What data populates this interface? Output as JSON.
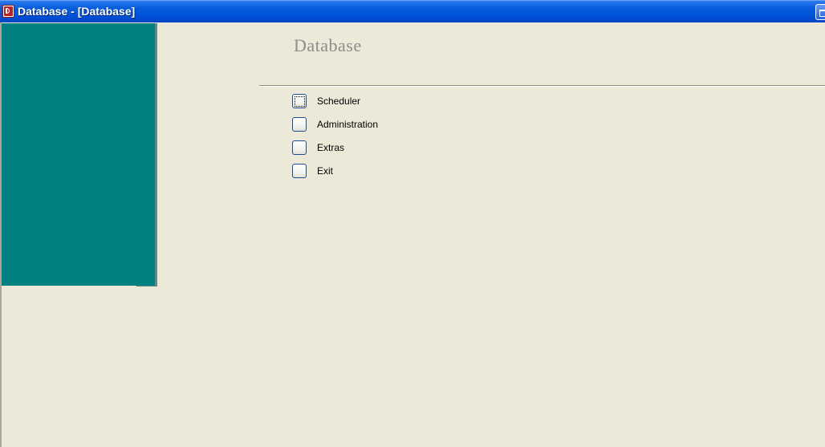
{
  "window": {
    "title": "Database - [Database]",
    "icon": "access-app-icon"
  },
  "form": {
    "title": "Database"
  },
  "menu": {
    "items": [
      {
        "label": "Scheduler",
        "focused": true
      },
      {
        "label": "Administration",
        "focused": false
      },
      {
        "label": "Extras",
        "focused": false
      },
      {
        "label": "Exit",
        "focused": false
      }
    ]
  },
  "colors": {
    "titlebar": "#0051d8",
    "sidebar": "#008080",
    "background": "#ece9d8"
  }
}
